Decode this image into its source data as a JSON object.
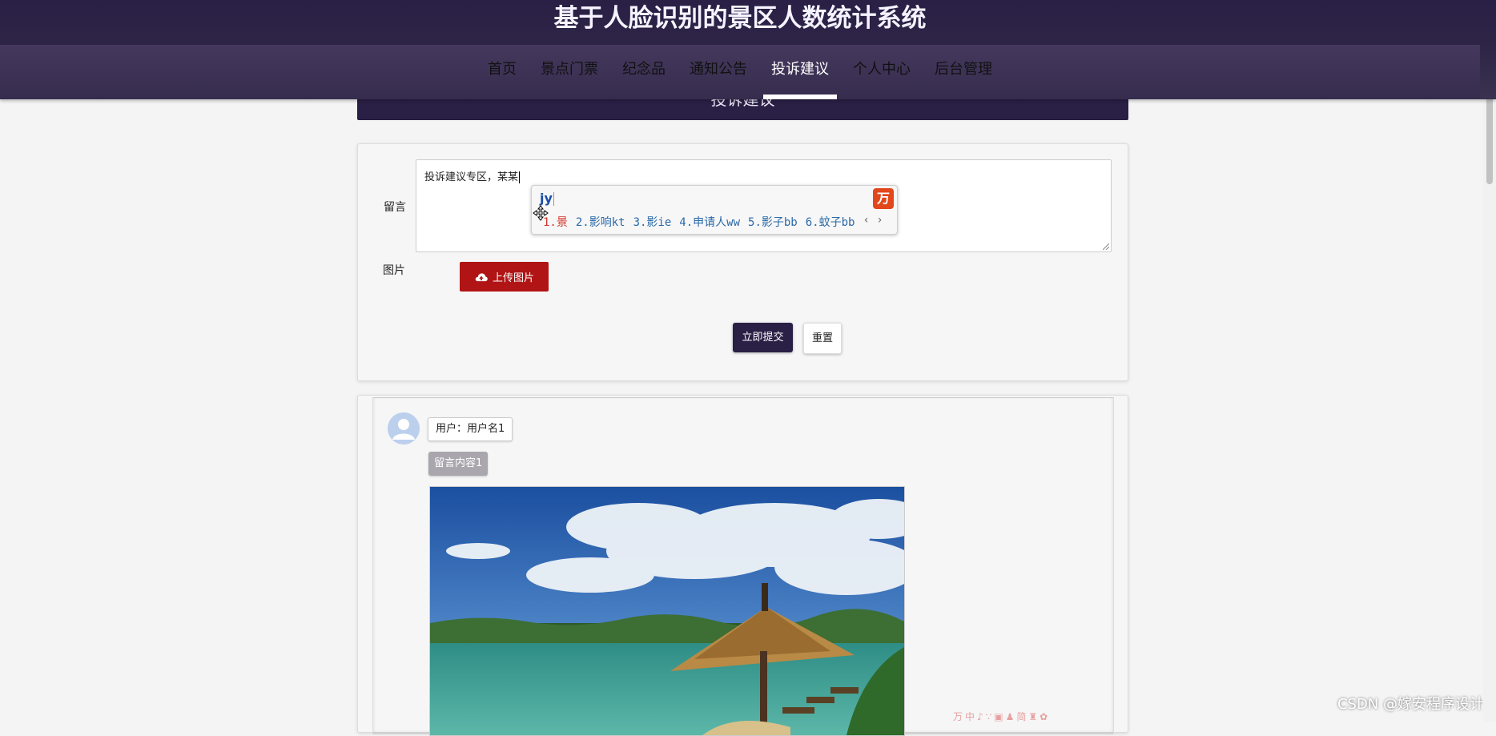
{
  "header": {
    "title": "基于人脸识别的景区人数统计系统",
    "nav": [
      "首页",
      "景点门票",
      "纪念品",
      "通知公告",
      "投诉建议",
      "个人中心",
      "后台管理"
    ],
    "active_index": 4
  },
  "banner": {
    "title": "投诉建议"
  },
  "form": {
    "message_label": "留言",
    "message_value": "投诉建议专区，某某",
    "image_label": "图片",
    "upload_label": "上传图片",
    "submit_label": "立即提交",
    "reset_label": "重置"
  },
  "ime": {
    "input": "jy",
    "logo": "万",
    "candidates": [
      "1.景",
      "2.影响kt",
      "3.影ie",
      "4.申请人ww",
      "5.影子bb",
      "6.蚊子bb"
    ],
    "pager": "‹ ›"
  },
  "messages": [
    {
      "user_label": "用户：用户名1",
      "content": "留言内容1"
    }
  ],
  "ime_toolbar": "万中♪∵▣♟简♜✿",
  "watermark": "CSDN @嫁安程序设计",
  "colors": {
    "header": "#2a1f45",
    "upload": "#b01414",
    "submit": "#2a1f45"
  }
}
